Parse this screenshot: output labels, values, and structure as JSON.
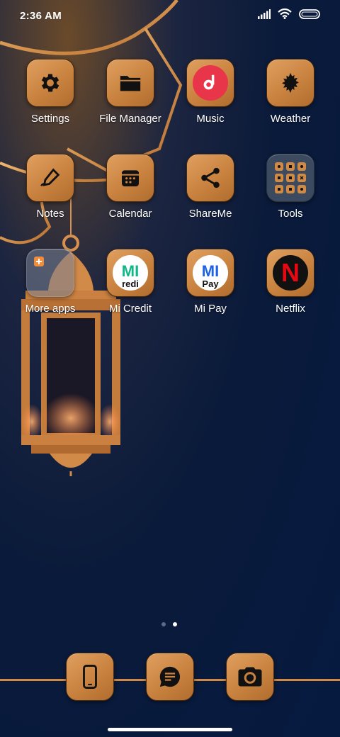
{
  "status_bar": {
    "time": "2:36 AM",
    "icons": [
      "signal-icon",
      "wifi-icon",
      "battery-icon"
    ]
  },
  "apps": [
    {
      "label": "Settings",
      "icon": "gear-icon"
    },
    {
      "label": "File Manager",
      "icon": "folder-icon"
    },
    {
      "label": "Music",
      "icon": "music-icon"
    },
    {
      "label": "Weather",
      "icon": "leaf-icon"
    },
    {
      "label": "Notes",
      "icon": "pen-icon"
    },
    {
      "label": "Calendar",
      "icon": "calendar-icon"
    },
    {
      "label": "ShareMe",
      "icon": "share-icon"
    },
    {
      "label": "Tools",
      "icon": "tools-folder-icon"
    },
    {
      "label": "More apps",
      "icon": "folder-icon"
    },
    {
      "label": "Mi Credit",
      "icon": "mi-credit-icon",
      "icon_text": "MI",
      "icon_subtext": "redi"
    },
    {
      "label": "Mi Pay",
      "icon": "mi-pay-icon",
      "icon_text": "MI",
      "icon_subtext": "Pay"
    },
    {
      "label": "Netflix",
      "icon": "netflix-icon",
      "icon_text": "N"
    }
  ],
  "page_indicator": {
    "pages": 2,
    "current": 2
  },
  "dock": [
    {
      "icon": "phone-icon"
    },
    {
      "icon": "messages-icon"
    },
    {
      "icon": "camera-icon"
    }
  ],
  "colors": {
    "accent": "#c9823f",
    "background": "#0a1a3a",
    "music_red": "#e8354a",
    "mi_credit_green": "#10b889",
    "mi_pay_blue": "#1e62e6",
    "netflix_red": "#e50914"
  }
}
